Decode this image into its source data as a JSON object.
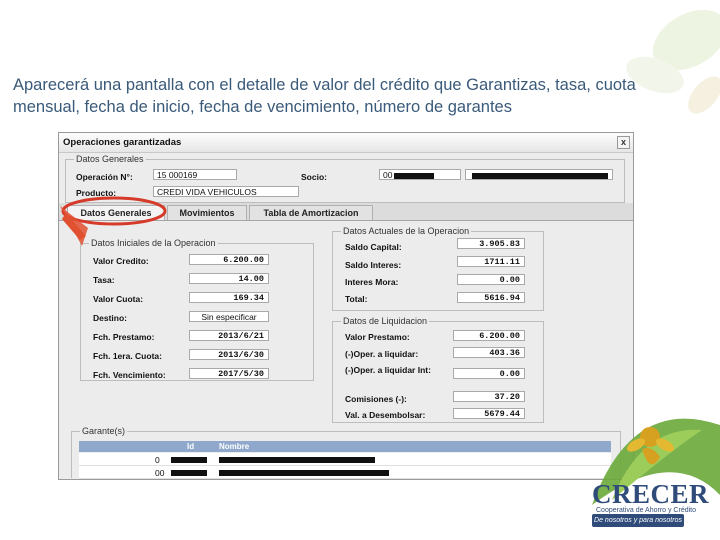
{
  "caption": "Aparecerá una pantalla con el detalle de valor del crédito que Garantizas, tasa, cuota mensual, fecha de inicio, fecha de vencimiento, número de garantes",
  "window": {
    "title": "Operaciones garantizadas",
    "close_label": "x"
  },
  "datos_generales": {
    "legend": "Datos Generales",
    "operacion_label": "Operación N°:",
    "operacion_value": "15 000169",
    "producto_label": "Producto:",
    "producto_value": "CREDI VIDA VEHICULOS",
    "socio_label": "Socio:",
    "socio_value": "00"
  },
  "tabs": [
    {
      "label": "Datos Generales",
      "active": true
    },
    {
      "label": "Movimientos",
      "active": false
    },
    {
      "label": "Tabla de Amortizacion",
      "active": false
    }
  ],
  "iniciales": {
    "legend": "Datos Iniciales de la Operacion",
    "fields": [
      {
        "label": "Valor Credito:",
        "value": "6.200.00"
      },
      {
        "label": "Tasa:",
        "value": "14.00"
      },
      {
        "label": "Valor Cuota:",
        "value": "169.34"
      },
      {
        "label": "Destino:",
        "value": "Sin especificar"
      },
      {
        "label": "Fch. Prestamo:",
        "value": "2013/6/21"
      },
      {
        "label": "Fch. 1era. Cuota:",
        "value": "2013/6/30"
      },
      {
        "label": "Fch. Vencimiento:",
        "value": "2017/5/30"
      }
    ]
  },
  "actuales": {
    "legend": "Datos Actuales de la Operacion",
    "fields": [
      {
        "label": "Saldo Capital:",
        "value": "3.905.83"
      },
      {
        "label": "Saldo Interes:",
        "value": "1711.11"
      },
      {
        "label": "Interes Mora:",
        "value": "0.00"
      },
      {
        "label": "Total:",
        "value": "5616.94"
      }
    ]
  },
  "liquidacion": {
    "legend": "Datos de Liquidacion",
    "fields": [
      {
        "label": "Valor Prestamo:",
        "value": "6.200.00"
      },
      {
        "label": "(-)Oper. a liquidar:",
        "value": "403.36"
      },
      {
        "label": "(-)Oper. a liquidar Int:",
        "value": "0.00"
      },
      {
        "label": "Comisiones (-):",
        "value": "37.20"
      },
      {
        "label": "Val. a Desembolsar:",
        "value": "5679.44"
      }
    ]
  },
  "garantes": {
    "legend": "Garante(s)",
    "columns": [
      "Id",
      "Nombre"
    ],
    "rows": [
      {
        "id": "0"
      },
      {
        "id": "00"
      }
    ]
  },
  "logo": {
    "name": "CRECER",
    "subtitle": "Cooperativa de Ahorro y Crédito",
    "tagline": "De nosotros y para nosotros"
  },
  "colors": {
    "caption": "#3a5a7a",
    "highlight_circle": "#d63a2a",
    "grid_header": "#8fa8cc",
    "logo_text": "#2e4b7a",
    "logo_green": "#6aa83a",
    "logo_gold": "#d6a020"
  }
}
